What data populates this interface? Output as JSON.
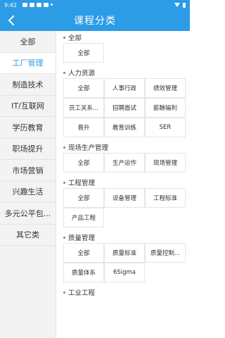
{
  "status_bar": {
    "time": "9:42"
  },
  "header": {
    "title": "课程分类"
  },
  "sidebar": {
    "items": [
      {
        "label": "全部"
      },
      {
        "label": "工厂管理"
      },
      {
        "label": "制造技术"
      },
      {
        "label": "IT/互联网"
      },
      {
        "label": "学历教育"
      },
      {
        "label": "职场提升"
      },
      {
        "label": "市场营销"
      },
      {
        "label": "兴趣生活"
      },
      {
        "label": "多元公平包..."
      },
      {
        "label": "其它类"
      }
    ]
  },
  "sections": [
    {
      "title": "全部",
      "items": [
        "全部"
      ]
    },
    {
      "title": "人力资源",
      "items": [
        "全部",
        "人事行政",
        "绩效管理",
        "员工关系...",
        "招聘面试",
        "薪酬福利",
        "晋升",
        "教育训练",
        "SER"
      ]
    },
    {
      "title": "现场生产管理",
      "items": [
        "全部",
        "生产运作",
        "现场管理"
      ]
    },
    {
      "title": "工程管理",
      "items": [
        "全部",
        "设备管理",
        "工程标准",
        "产品工程"
      ]
    },
    {
      "title": "质量管理",
      "items": [
        "全部",
        "质量标准",
        "质量控制...",
        "质量体系",
        "6Sigma"
      ]
    },
    {
      "title": "工业工程",
      "items": []
    }
  ],
  "colors": {
    "brand": "#2c9ce6",
    "sidebar_bg": "#f3f3f3"
  }
}
